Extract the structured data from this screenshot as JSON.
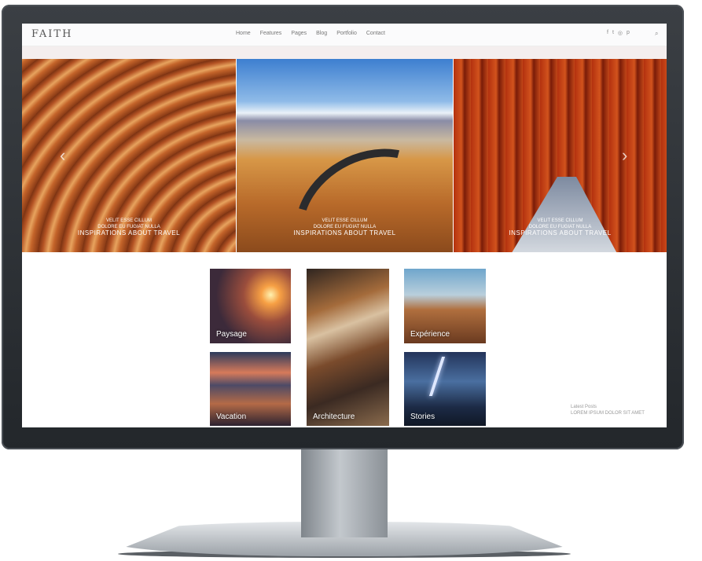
{
  "site": {
    "logo": "FAITH",
    "menu": [
      "Home",
      "Features",
      "Pages",
      "Blog",
      "Portfolio",
      "Contact"
    ],
    "social_icons": [
      "facebook-icon",
      "twitter-icon",
      "instagram-icon",
      "pinterest-icon"
    ],
    "search_icon": "search-icon"
  },
  "slider": {
    "slides": [
      {
        "line1": "VELIT ESSE CILLUM",
        "line2": "DOLORE EU FUGIAT NULLA",
        "line3": "INSPIRATIONS ABOUT TRAVEL"
      },
      {
        "line1": "VELIT ESSE CILLUM",
        "line2": "DOLORE EU FUGIAT NULLA",
        "line3": "INSPIRATIONS ABOUT TRAVEL"
      },
      {
        "line1": "VELIT ESSE CILLUM",
        "line2": "DOLORE EU FUGIAT NULLA",
        "line3": "INSPIRATIONS ABOUT TRAVEL"
      }
    ],
    "prev_icon": "‹",
    "next_icon": "›"
  },
  "tiles": {
    "paysage": "Paysage",
    "architecture": "Architecture",
    "experience": "Expérience",
    "vacation": "Vacation",
    "stories": "Stories"
  },
  "aside": {
    "line1": "Latest Posts",
    "line2": "LOREM IPSUM DOLOR SIT AMET"
  },
  "colors": {
    "bezel": "#2b2f33",
    "nav_bg": "#fbfbfc",
    "pink_bar": "#f4eeee"
  }
}
